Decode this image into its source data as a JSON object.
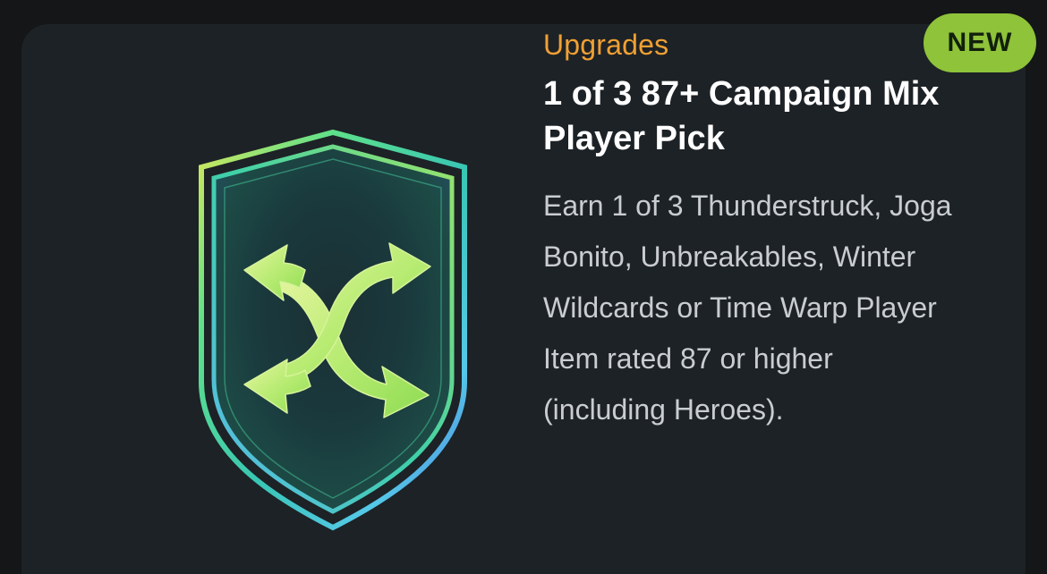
{
  "card": {
    "category": "Upgrades",
    "title": "1 of 3 87+ Campaign Mix Player Pick",
    "description": "Earn 1 of 3 Thunderstruck, Joga Bonito, Unbreakables, Winter Wildcards or Time Warp Player Item rated 87 or higher (including Heroes).",
    "badge": "NEW",
    "icon": "shuffle-shield-icon"
  },
  "colors": {
    "background": "#141617",
    "card": "#1d2226",
    "category": "#f0a033",
    "title": "#ffffff",
    "description": "#c9cdd2",
    "badge": "#8ec33a",
    "badge_text": "#12200b"
  }
}
